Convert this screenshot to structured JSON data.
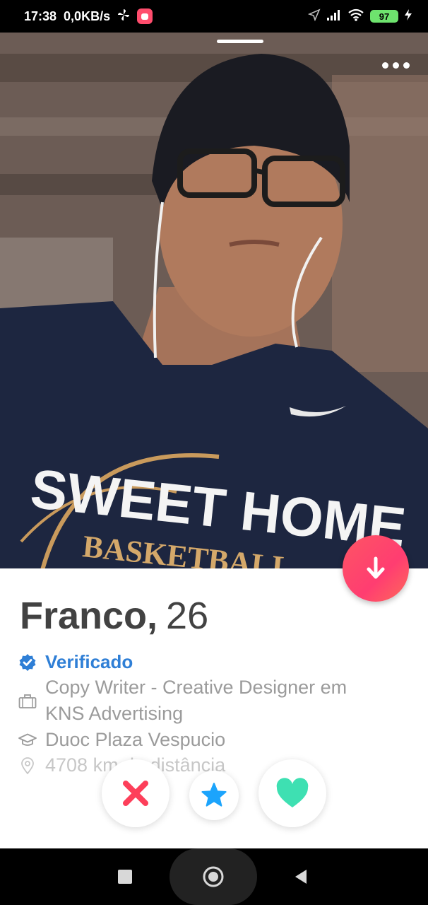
{
  "status_bar": {
    "time": "17:38",
    "network_speed": "0,0KB/s",
    "battery": "97",
    "icons": [
      "fan-icon",
      "notification-app-icon",
      "location-arrow-icon",
      "signal-icon",
      "wifi-icon",
      "battery-icon",
      "charging-icon"
    ]
  },
  "profile": {
    "name": "Franco,",
    "age": "26",
    "verified_label": "Verificado",
    "job": [
      "Copy Writer - Creative Designer em",
      "KNS Advertising"
    ],
    "school": "Duoc Plaza Vespucio",
    "distance": "4708 km de distância",
    "photo_shirt_text": [
      "SWEET HOME",
      "BASKETBALL"
    ]
  },
  "actions": {
    "nope": "close-icon",
    "superlike": "star-icon",
    "like": "heart-icon"
  },
  "colors": {
    "accent_red": "#fd5564",
    "verified_blue": "#2f7fd6",
    "superlike_blue": "#1ca4fc",
    "like_green": "#3ee0b2",
    "nope_red": "#fd3f5a"
  }
}
